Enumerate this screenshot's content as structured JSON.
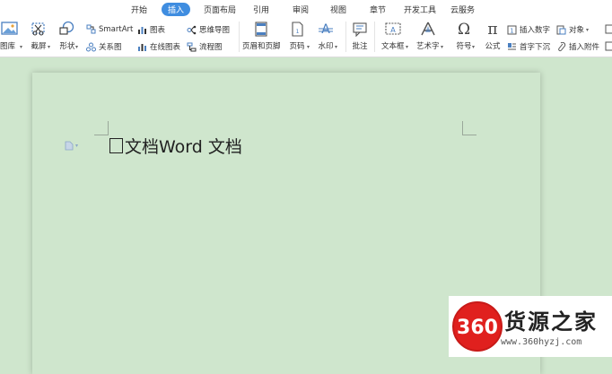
{
  "tabs": [
    "开始",
    "插入",
    "页面布局",
    "引用",
    "审阅",
    "视图",
    "章节",
    "开发工具",
    "云服务"
  ],
  "ribbon": {
    "picture": "图库",
    "screenshot": "截屏",
    "shapes": "形状",
    "smartart": "SmartArt",
    "chart": "图表",
    "relation": "关系图",
    "online_chart": "在线图表",
    "mindmap": "思维导图",
    "flowchart": "流程图",
    "header_footer": "页眉和页脚",
    "page_number": "页码",
    "watermark": "水印",
    "comment": "批注",
    "textbox": "文本框",
    "wordart": "艺术字",
    "symbol": "符号",
    "formula": "公式",
    "insert_number": "插入数字",
    "dropcap": "首字下沉",
    "object": "对象",
    "attachment": "插入附件"
  },
  "document": {
    "text": "文档Word 文档"
  },
  "watermark": {
    "logo": "360",
    "name": "货源之家",
    "url": "www.360hyzj.com"
  },
  "colors": {
    "active_tab": "#3f8de0",
    "page_bg": "#cfe6cd",
    "logo_red": "#e0201e"
  }
}
